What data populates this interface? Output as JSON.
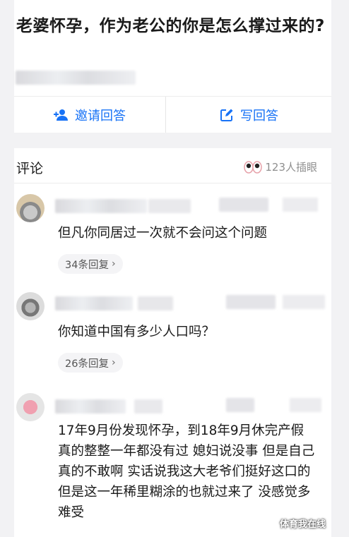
{
  "question": {
    "title": "老婆怀孕，作为老公的你是怎么撑过来的?"
  },
  "actions": {
    "invite_label": "邀请回答",
    "write_label": "写回答"
  },
  "comments_header": {
    "title": "评论",
    "reaction_count": "123人插眼"
  },
  "comments": [
    {
      "text": "但凡你同居过一次就不会问这个问题",
      "replies": "34条回复"
    },
    {
      "text": "你知道中国有多少人口吗？",
      "replies": "26条回复"
    },
    {
      "text": "17年9月份发现怀孕，到18年9月休完产假 真的整整一年都没有过 媳妇说没事 但是自己真的不敢啊 实话说我这大老爷们挺好这口的 但是这一年稀里糊涂的也就过来了 没感觉多难受"
    }
  ],
  "watermark": "体育我在线",
  "colors": {
    "accent": "#1772f6",
    "background": "#f2f2f4",
    "card": "#ffffff",
    "text": "#1a1a1a",
    "muted": "#8f8f8f"
  },
  "icons": {
    "invite": "add-user-icon",
    "write": "pen-box-icon",
    "reaction": "eyes-icon",
    "reply": "chevron-right-icon"
  }
}
